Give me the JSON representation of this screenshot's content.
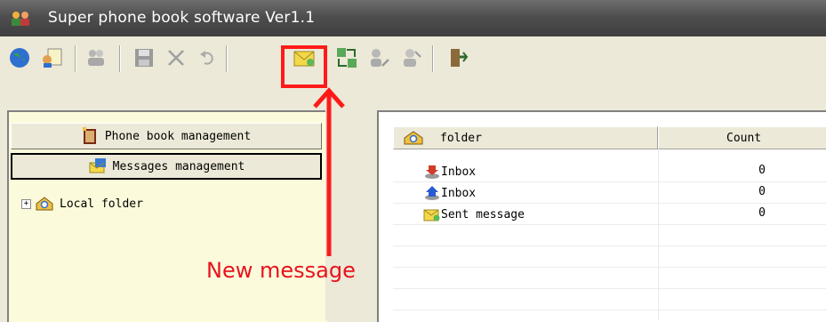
{
  "window": {
    "title": "Super phone book software Ver1.1"
  },
  "toolbar": {
    "buttons": [
      {
        "icon": "globe-icon"
      },
      {
        "icon": "contact-card-icon"
      },
      {
        "icon": "users-icon"
      },
      {
        "icon": "save-icon"
      },
      {
        "icon": "delete-icon"
      },
      {
        "icon": "undo-icon"
      },
      {
        "icon": "new-message-icon"
      },
      {
        "icon": "transfer-icon"
      },
      {
        "icon": "user-edit-icon"
      },
      {
        "icon": "user-settings-icon"
      },
      {
        "icon": "exit-icon"
      }
    ]
  },
  "left_panel": {
    "phone_book_label": "Phone book management",
    "messages_label": "Messages management",
    "tree_root": "Local folder"
  },
  "right_panel": {
    "columns": {
      "folder": "folder",
      "count": "Count"
    },
    "rows": [
      {
        "name": "Inbox",
        "count": "0"
      },
      {
        "name": "Inbox",
        "count": "0"
      },
      {
        "name": "Sent message",
        "count": "0"
      }
    ]
  },
  "callout": {
    "text": "New message",
    "color": "#e8121d"
  }
}
